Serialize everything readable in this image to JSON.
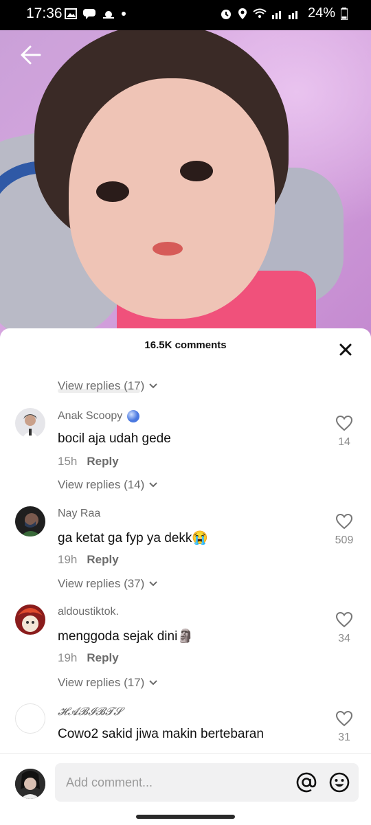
{
  "status_bar": {
    "time": "17:36",
    "battery": "24%"
  },
  "video": {
    "back_icon": "arrow-left-icon"
  },
  "comments_panel": {
    "title": "16.5K comments",
    "close_icon": "close-icon",
    "comments": [
      {
        "view_replies_before": "View replies (17)",
        "username": "Anak Scoopy",
        "text": "bocil aja udah gede",
        "time": "15h",
        "reply_label": "Reply",
        "likes": "14",
        "view_replies_after": "View replies (14)"
      },
      {
        "username": "Nay Raa",
        "text": "ga ketat ga fyp ya dekk😭",
        "time": "19h",
        "reply_label": "Reply",
        "likes": "509",
        "view_replies_after": "View replies (37)"
      },
      {
        "username": "aldoustiktok.",
        "text": "menggoda sejak dini🗿",
        "time": "19h",
        "reply_label": "Reply",
        "likes": "34",
        "view_replies_after": "View replies (17)"
      },
      {
        "username": "𝓗𝓐𝓑𝓘𝓑𝓣𝓢",
        "text": "Cowo2 sakid jiwa makin bertebaran",
        "likes": "31"
      }
    ]
  },
  "composer": {
    "placeholder": "Add comment..."
  }
}
